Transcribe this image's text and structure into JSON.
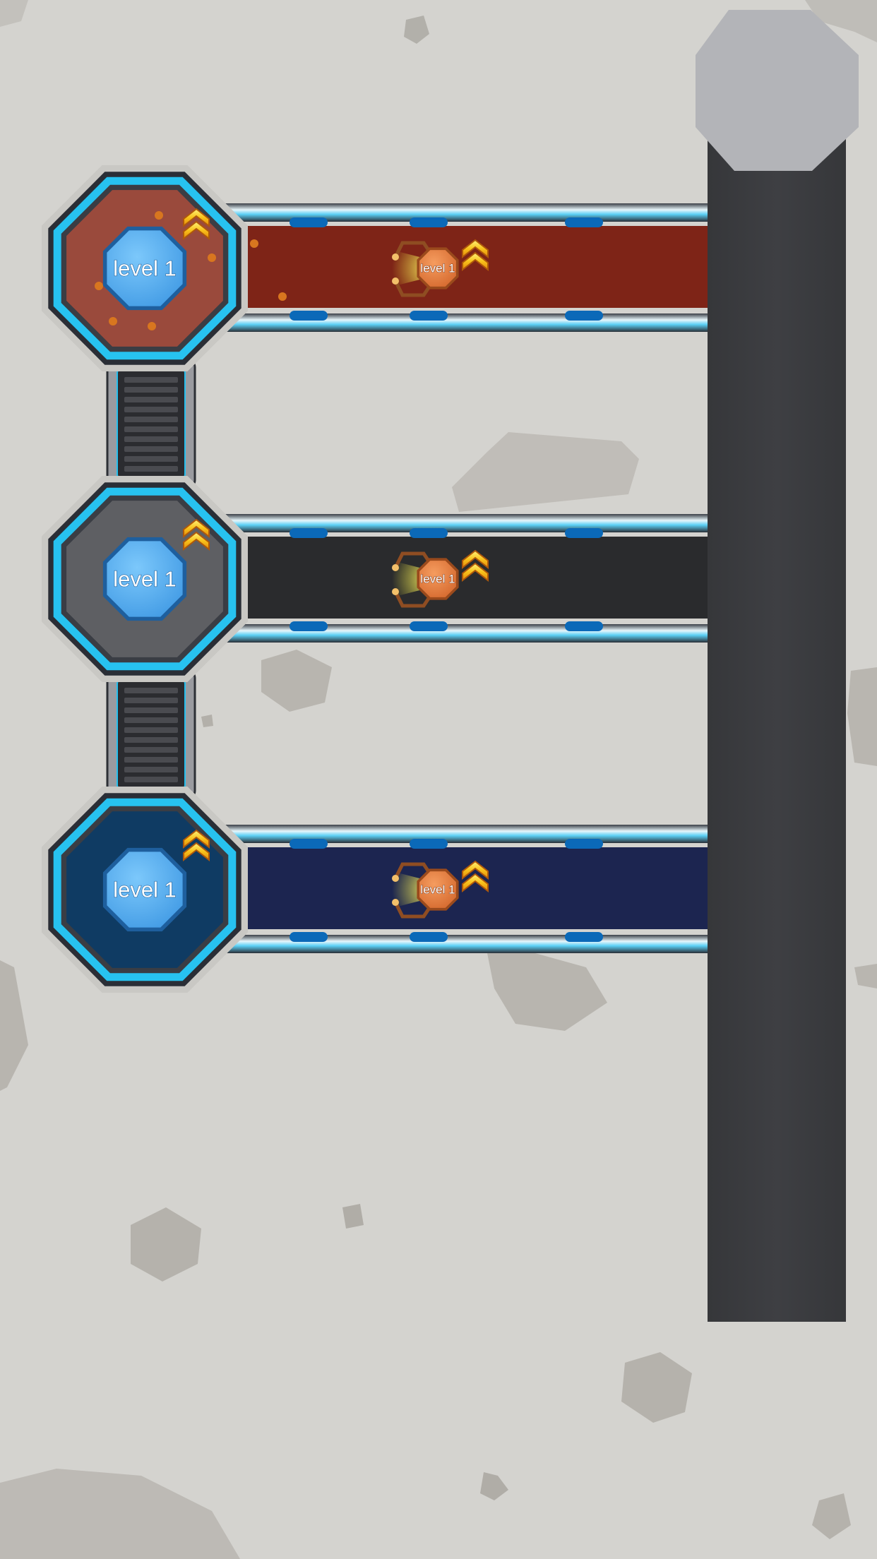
{
  "colors": {
    "background": "#d4d3cf",
    "tower": "#3b3c3f",
    "tower_cap": "#b3b4b8",
    "frame_cyan": "#27c2f0",
    "frame_blue": "#0b69b8",
    "mine_red": "#7e2417",
    "mine_dark": "#2a2b2d",
    "mine_navy": "#1c2550",
    "core_blue": "#5ab2f3",
    "robot_orange": "#e07a3e",
    "upgrade_gold": "#f6c223"
  },
  "mines": [
    {
      "theme": "lava",
      "core_label": "level 1",
      "robot_label": "level 1",
      "core_upgrade_icon": "double-chevron-up-icon",
      "robot_upgrade_icon": "double-chevron-up-icon"
    },
    {
      "theme": "rock",
      "core_label": "level 1",
      "robot_label": "level 1",
      "core_upgrade_icon": "double-chevron-up-icon",
      "robot_upgrade_icon": "double-chevron-up-icon"
    },
    {
      "theme": "tech",
      "core_label": "level 1",
      "robot_label": "level 1",
      "core_upgrade_icon": "double-chevron-up-icon",
      "robot_upgrade_icon": "double-chevron-up-icon"
    }
  ],
  "connectors": [
    {
      "icon": "elevator-shaft-icon"
    },
    {
      "icon": "elevator-shaft-icon"
    }
  ],
  "tower": {
    "cap_icon": "octagon-cap-icon"
  }
}
